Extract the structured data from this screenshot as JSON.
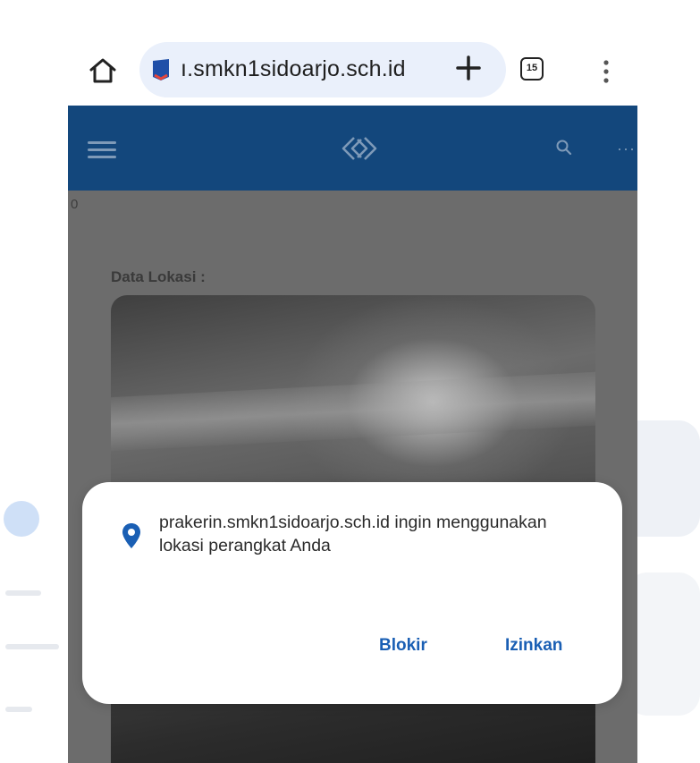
{
  "browser": {
    "url_text": "ı.smkn1sidoarjo.sch.id",
    "tab_count": "15",
    "icons": {
      "home": "home-icon",
      "site": "site-favicon-icon",
      "new_tab": "plus-icon",
      "tabs": "tab-switcher-icon",
      "menu": "more-vertical-icon"
    }
  },
  "app": {
    "header_color": "#13477c",
    "icons": {
      "menu": "hamburger-icon",
      "logo": "app-logo-icon",
      "search": "search-icon",
      "more": "more-horizontal-icon"
    },
    "overflow_text": "0",
    "section_label": "Data Lokasi :"
  },
  "permission_dialog": {
    "message": "prakerin.smkn1sidoarjo.sch.id ingin menggunakan lokasi perangkat Anda",
    "icon": "location-pin-icon",
    "block_label": "Blokir",
    "allow_label": "Izinkan",
    "accent_color": "#1a5fb4"
  }
}
